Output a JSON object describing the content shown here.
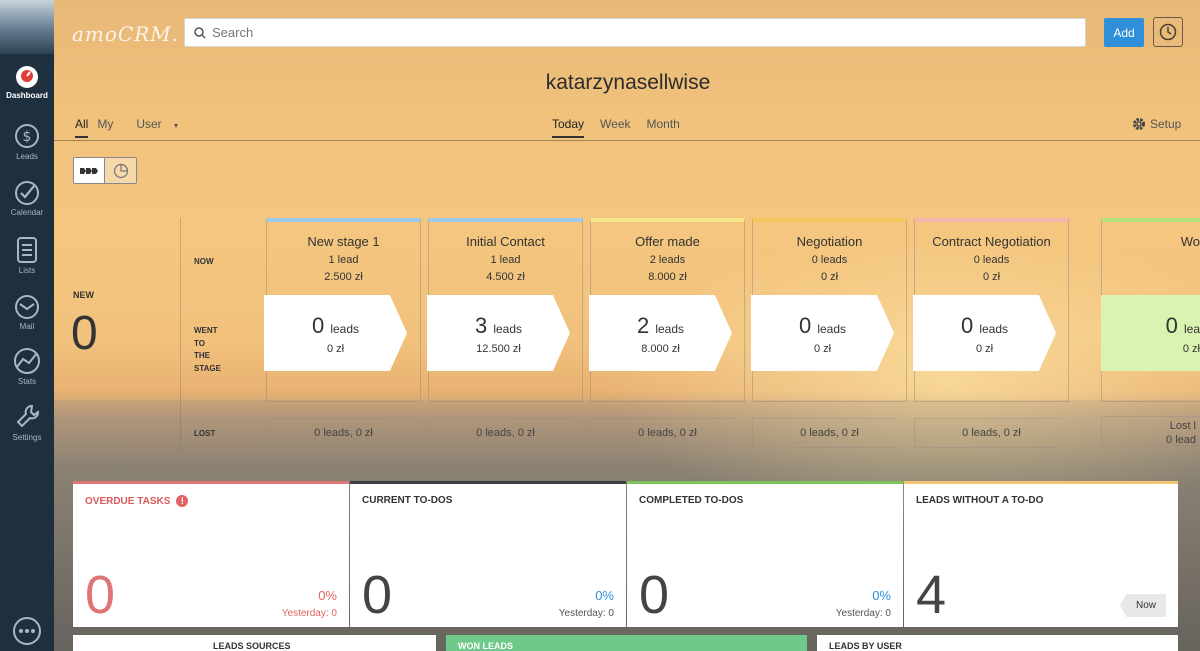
{
  "header": {
    "logo": "amoCRM.",
    "search_placeholder": "Search",
    "add_label": "Add",
    "title": "katarzynasellwise"
  },
  "sidebar": {
    "items": [
      {
        "label": "Dashboard",
        "icon": "gauge-icon"
      },
      {
        "label": "Leads",
        "icon": "dollar-icon"
      },
      {
        "label": "Calendar",
        "icon": "check-circle-icon"
      },
      {
        "label": "Lists",
        "icon": "list-icon"
      },
      {
        "label": "Mail",
        "icon": "mail-icon"
      },
      {
        "label": "Stats",
        "icon": "stats-icon"
      },
      {
        "label": "Settings",
        "icon": "wrench-icon"
      }
    ]
  },
  "filters": {
    "all": "All",
    "my": "My",
    "user": "User",
    "periods": [
      "Today",
      "Week",
      "Month"
    ],
    "setup": "Setup"
  },
  "pipeline": {
    "new_label": "NEW",
    "new_count": "0",
    "row_now": "NOW",
    "row_went": [
      "WENT",
      "TO",
      "THE",
      "STAGE"
    ],
    "row_lost": "LOST",
    "stages": [
      {
        "name": "New stage 1",
        "now_leads": "1 lead",
        "now_amount": "2.500 zł",
        "went_count": "0",
        "went_unit": "leads",
        "went_amount": "0 zł",
        "lost": "0 leads, 0 zł",
        "color": "#9ccbea"
      },
      {
        "name": "Initial Contact",
        "now_leads": "1 lead",
        "now_amount": "4.500 zł",
        "went_count": "3",
        "went_unit": "leads",
        "went_amount": "12.500 zł",
        "lost": "0 leads, 0 zł",
        "color": "#9ccbea"
      },
      {
        "name": "Offer made",
        "now_leads": "2 leads",
        "now_amount": "8.000 zł",
        "went_count": "2",
        "went_unit": "leads",
        "went_amount": "8.000 zł",
        "lost": "0 leads, 0 zł",
        "color": "#f7e58a"
      },
      {
        "name": "Negotiation",
        "now_leads": "0 leads",
        "now_amount": "0 zł",
        "went_count": "0",
        "went_unit": "leads",
        "went_amount": "0 zł",
        "lost": "0 leads, 0 zł",
        "color": "#f4c65c"
      },
      {
        "name": "Contract Negotiation",
        "now_leads": "0 leads",
        "now_amount": "0 zł",
        "went_count": "0",
        "went_unit": "leads",
        "went_amount": "0 zł",
        "lost": "0 leads, 0 zł",
        "color": "#f6b6b0"
      },
      {
        "name": "Wo",
        "now_leads": "",
        "now_amount": "",
        "went_count": "0",
        "went_unit": "lea",
        "went_amount": "0 zł",
        "lost": "Lost l",
        "lost2": "0 lead",
        "color": "#b6e07a"
      }
    ]
  },
  "cards": [
    {
      "title": "OVERDUE TASKS",
      "num": "0",
      "pct": "0%",
      "yesterday": "Yesterday: 0",
      "color": "#e07575"
    },
    {
      "title": "CURRENT TO-DOS",
      "num": "0",
      "pct": "0%",
      "yesterday": "Yesterday: 0",
      "color": "#3a3f4a"
    },
    {
      "title": "COMPLETED TO-DOS",
      "num": "0",
      "pct": "0%",
      "yesterday": "Yesterday: 0",
      "color": "#7cc45a"
    },
    {
      "title": "LEADS WITHOUT A TO-DO",
      "num": "4",
      "tag": "Now",
      "color": "#f1c571"
    }
  ],
  "bottom_cards": [
    "LEADS SOURCES",
    "WON LEADS",
    "LEADS BY USER"
  ]
}
